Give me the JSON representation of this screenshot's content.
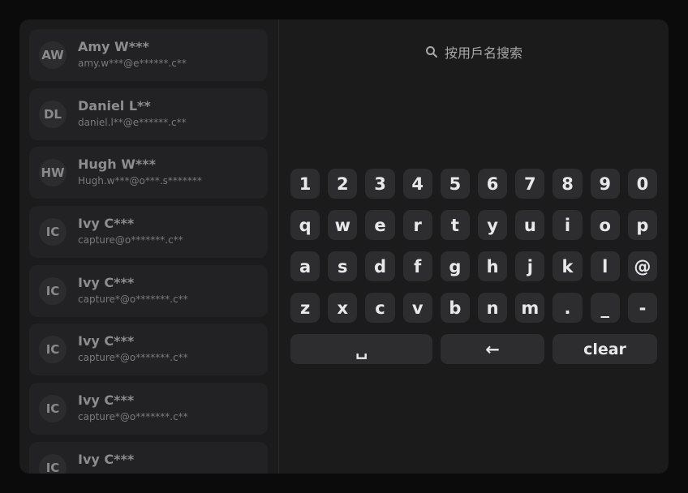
{
  "users": [
    {
      "initials": "AW",
      "name": "Amy W***",
      "email": "amy.w***@e******.c**"
    },
    {
      "initials": "DL",
      "name": "Daniel L**",
      "email": "daniel.l**@e******.c**"
    },
    {
      "initials": "HW",
      "name": "Hugh W***",
      "email": "Hugh.w***@o***.s*******"
    },
    {
      "initials": "IC",
      "name": "Ivy C***",
      "email": "capture@o*******.c**"
    },
    {
      "initials": "IC",
      "name": "Ivy C***",
      "email": "capture*@o*******.c**"
    },
    {
      "initials": "IC",
      "name": "Ivy C***",
      "email": "capture*@o*******.c**"
    },
    {
      "initials": "IC",
      "name": "Ivy C***",
      "email": "capture*@o*******.c**"
    },
    {
      "initials": "IC",
      "name": "Ivy C***",
      "email": ""
    }
  ],
  "search": {
    "placeholder": "按用戶名搜索",
    "icon": "search-icon"
  },
  "keyboard": {
    "rows": [
      [
        "1",
        "2",
        "3",
        "4",
        "5",
        "6",
        "7",
        "8",
        "9",
        "0"
      ],
      [
        "q",
        "w",
        "e",
        "r",
        "t",
        "y",
        "u",
        "i",
        "o",
        "p"
      ],
      [
        "a",
        "s",
        "d",
        "f",
        "g",
        "h",
        "j",
        "k",
        "l",
        "@"
      ],
      [
        "z",
        "x",
        "c",
        "v",
        "b",
        "n",
        "m",
        ".",
        "_",
        "-"
      ]
    ],
    "space_label": "␣",
    "backspace_label": "←",
    "clear_label": "clear"
  }
}
